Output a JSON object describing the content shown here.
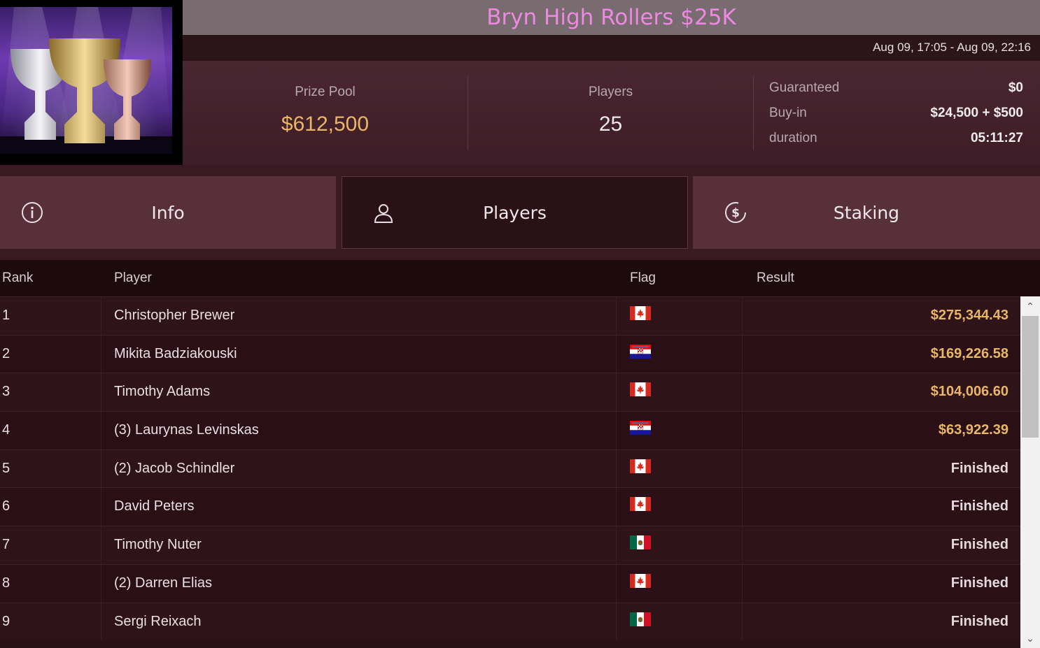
{
  "tournament": {
    "title": "Bryn High Rollers $25K",
    "date_range": "Aug 09, 17:05 - Aug 09, 22:16"
  },
  "stats": {
    "prize_pool_label": "Prize Pool",
    "prize_pool_value": "$612,500",
    "players_label": "Players",
    "players_value": "25",
    "guaranteed_label": "Guaranteed",
    "guaranteed_value": "$0",
    "buyin_label": "Buy-in",
    "buyin_value": "$24,500 + $500",
    "duration_label": "duration",
    "duration_value": "05:11:27"
  },
  "tabs": [
    {
      "label": "Info",
      "icon": "info-icon"
    },
    {
      "label": "Players",
      "icon": "user-icon"
    },
    {
      "label": "Staking",
      "icon": "dollar-coin-icon"
    }
  ],
  "active_tab": "Players",
  "table": {
    "headers": {
      "rank": "Rank",
      "player": "Player",
      "flag": "Flag",
      "result": "Result"
    },
    "rows": [
      {
        "rank": "1",
        "player": "Christopher Brewer",
        "flag": "canada-flag",
        "result": "$275,344.43"
      },
      {
        "rank": "2",
        "player": "Mikita Badziakouski",
        "flag": "croatia-flag",
        "result": "$169,226.58"
      },
      {
        "rank": "3",
        "player": "Timothy Adams",
        "flag": "canada-flag",
        "result": "$104,006.60"
      },
      {
        "rank": "4",
        "player": "(3) Laurynas Levinskas",
        "flag": "croatia-flag",
        "result": "$63,922.39"
      },
      {
        "rank": "5",
        "player": "(2) Jacob Schindler",
        "flag": "canada-flag",
        "result": "Finished"
      },
      {
        "rank": "6",
        "player": "David Peters",
        "flag": "canada-flag",
        "result": "Finished"
      },
      {
        "rank": "7",
        "player": "Timothy Nuter",
        "flag": "mexico-flag",
        "result": "Finished"
      },
      {
        "rank": "8",
        "player": "(2) Darren Elias",
        "flag": "canada-flag",
        "result": "Finished"
      },
      {
        "rank": "9",
        "player": "Sergi Reixach",
        "flag": "mexico-flag",
        "result": "Finished"
      }
    ]
  },
  "colors": {
    "title": "#ee88e0",
    "money": "#e8b766",
    "background": "#2a1117"
  }
}
